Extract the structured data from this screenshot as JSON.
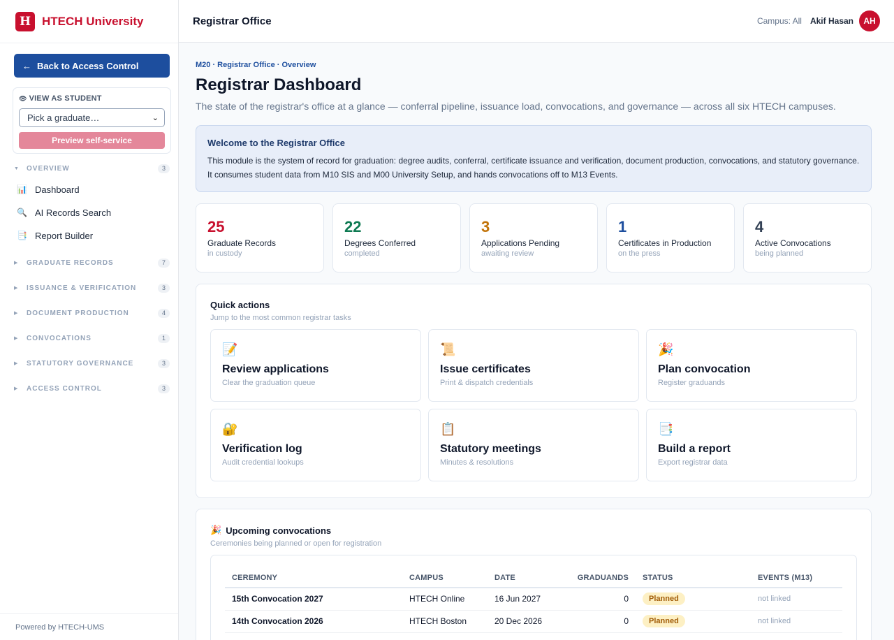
{
  "brand": {
    "logo_letter": "H",
    "name": "HTECH University",
    "color": "#c8102e"
  },
  "sidebar": {
    "back_label": "Back to Access Control",
    "view_as": {
      "title": "VIEW AS STUDENT",
      "select_value": "Pick a graduate…",
      "preview_label": "Preview self-service"
    },
    "overview": {
      "label": "OVERVIEW",
      "count": "3"
    },
    "items": [
      {
        "icon": "📊",
        "label": "Dashboard"
      },
      {
        "icon": "🔍",
        "label": "AI Records Search"
      },
      {
        "icon": "📑",
        "label": "Report Builder"
      }
    ],
    "sections": [
      {
        "label": "GRADUATE RECORDS",
        "count": "7"
      },
      {
        "label": "ISSUANCE & VERIFICATION",
        "count": "3"
      },
      {
        "label": "DOCUMENT PRODUCTION",
        "count": "4"
      },
      {
        "label": "CONVOCATIONS",
        "count": "1"
      },
      {
        "label": "STATUTORY GOVERNANCE",
        "count": "3"
      },
      {
        "label": "ACCESS CONTROL",
        "count": "3"
      }
    ],
    "footer": "Powered by HTECH-UMS"
  },
  "header": {
    "title": "Registrar Office",
    "campus": "Campus: All",
    "user": "Akif Hasan",
    "avatar": "AH"
  },
  "main": {
    "breadcrumb": "M20 · Registrar Office · Overview",
    "title": "Registrar Dashboard",
    "subtitle": "The state of the registrar's office at a glance — conferral pipeline, issuance load, convocations, and governance — across all six HTECH campuses.",
    "welcome": {
      "title": "Welcome to the Registrar Office",
      "line1": "This module is the system of record for graduation: degree audits, conferral, certificate issuance and verification, document production, convocations, and statutory governance.",
      "line2": "It consumes student data from M10 SIS and M00 University Setup, and hands convocations off to M13 Events."
    },
    "stats": [
      {
        "value": "25",
        "label": "Graduate Records",
        "sub": "in custody",
        "color": "#c8102e"
      },
      {
        "value": "22",
        "label": "Degrees Conferred",
        "sub": "completed",
        "color": "#0e7a52"
      },
      {
        "value": "3",
        "label": "Applications Pending",
        "sub": "awaiting review",
        "color": "#c2740a"
      },
      {
        "value": "1",
        "label": "Certificates in Production",
        "sub": "on the press",
        "color": "#1d4e9e"
      },
      {
        "value": "4",
        "label": "Active Convocations",
        "sub": "being planned",
        "color": "#334155"
      }
    ],
    "quick_actions": {
      "title": "Quick actions",
      "subtitle": "Jump to the most common registrar tasks",
      "tiles": [
        {
          "icon": "📝",
          "title": "Review applications",
          "sub": "Clear the graduation queue"
        },
        {
          "icon": "📜",
          "title": "Issue certificates",
          "sub": "Print & dispatch credentials"
        },
        {
          "icon": "🎉",
          "title": "Plan convocation",
          "sub": "Register graduands"
        },
        {
          "icon": "🔐",
          "title": "Verification log",
          "sub": "Audit credential lookups"
        },
        {
          "icon": "📋",
          "title": "Statutory meetings",
          "sub": "Minutes & resolutions"
        },
        {
          "icon": "📑",
          "title": "Build a report",
          "sub": "Export registrar data"
        }
      ]
    },
    "convocations": {
      "icon": "🎉",
      "title": "Upcoming convocations",
      "subtitle": "Ceremonies being planned or open for registration",
      "columns": [
        "CEREMONY",
        "CAMPUS",
        "DATE",
        "GRADUANDS",
        "STATUS",
        "EVENTS (M13)"
      ],
      "rows": [
        {
          "ceremony": "15th Convocation 2027",
          "campus": "HTECH Online",
          "date": "16 Jun 2027",
          "graduands": "0",
          "status": "Planned",
          "events": "not linked"
        },
        {
          "ceremony": "14th Convocation 2026",
          "campus": "HTECH Boston",
          "date": "20 Dec 2026",
          "graduands": "0",
          "status": "Planned",
          "events": "not linked"
        }
      ]
    }
  }
}
